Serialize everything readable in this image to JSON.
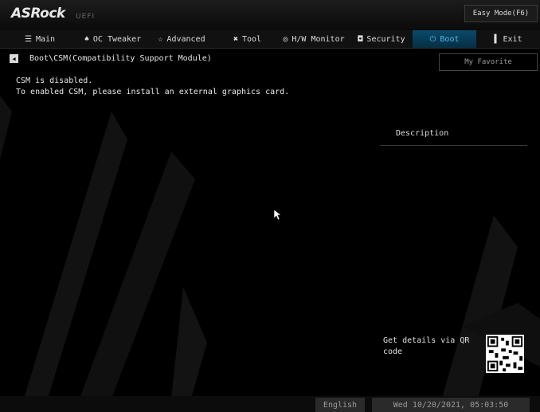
{
  "header": {
    "logo": "ASRock",
    "uefi": "UEFI",
    "easy_mode": "Easy Mode(F6)"
  },
  "tabs": [
    {
      "label": "Main",
      "icon": "list-icon",
      "glyph": "☰"
    },
    {
      "label": "OC Tweaker",
      "icon": "rocket-icon",
      "glyph": "♠"
    },
    {
      "label": "Advanced",
      "icon": "star-icon",
      "glyph": "☆"
    },
    {
      "label": "Tool",
      "icon": "tools-icon",
      "glyph": "✖"
    },
    {
      "label": "H/W Monitor",
      "icon": "monitor-icon",
      "glyph": "◎"
    },
    {
      "label": "Security",
      "icon": "shield-icon",
      "glyph": "◘"
    },
    {
      "label": "Boot",
      "icon": "power-icon",
      "glyph": "⏻",
      "active": true
    },
    {
      "label": "Exit",
      "icon": "exit-icon",
      "glyph": "▌"
    }
  ],
  "breadcrumb": "Boot\\CSM(Compatibility Support Module)",
  "my_favorite": "My Favorite",
  "messages": [
    "CSM is disabled.",
    "To enabled CSM, please install an external graphics card."
  ],
  "description_title": "Description",
  "qr_text": "Get details via QR code",
  "footer": {
    "language": "English",
    "datetime": "Wed 10/20/2021, 05:03:50"
  },
  "colors": {
    "active_tab": "#0a4a6a",
    "active_tab_text": "#4fb9ea",
    "background": "#000000"
  }
}
